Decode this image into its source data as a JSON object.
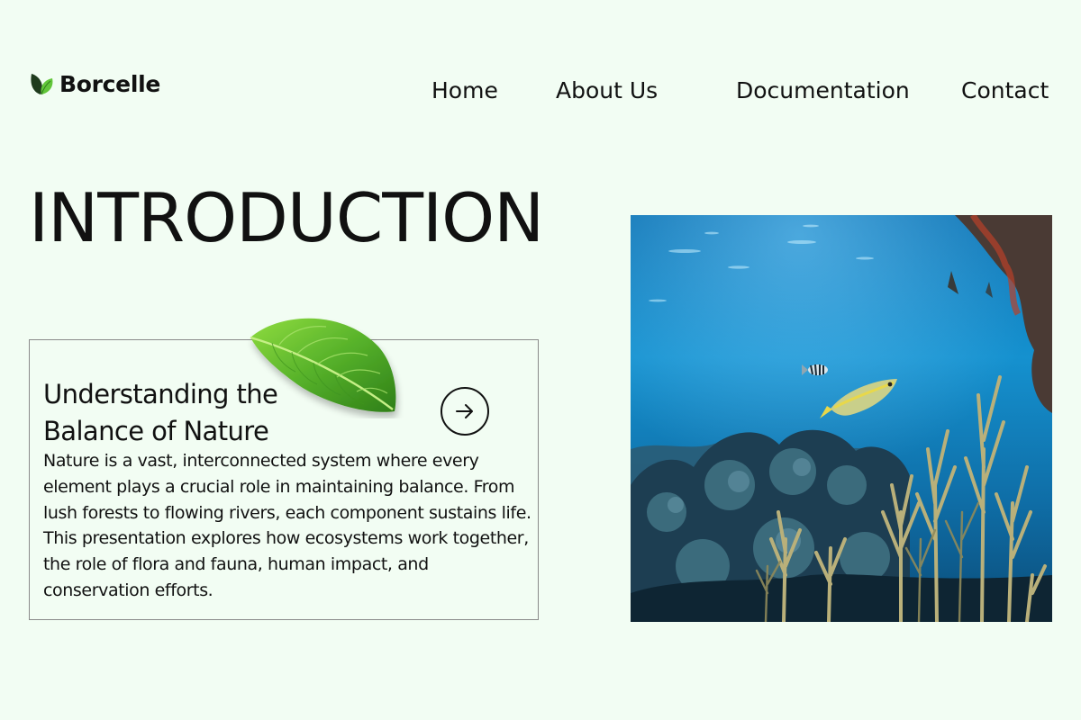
{
  "brand": {
    "name": "Borcelle"
  },
  "nav": {
    "items": [
      {
        "label": "Home"
      },
      {
        "label": "About Us"
      },
      {
        "label": "Documentation"
      },
      {
        "label": "Contact"
      }
    ]
  },
  "hero": {
    "title": "INTRODUCTION"
  },
  "card": {
    "title": "Understanding the Balance of Nature",
    "body": "Nature is a vast, interconnected system where every element plays a crucial role in maintaining balance. From lush forests to flowing rivers, each component sustains life. This presentation explores how ecosystems work together, the role of flora and fauna, human impact, and conservation efforts."
  },
  "icons": {
    "brand_logo": "leaf-icon",
    "card_action": "arrow-right-icon"
  },
  "colors": {
    "background": "#f2fdf3",
    "text": "#111111",
    "leaf_green": "#4caf2a",
    "ocean_blue": "#0a73b5"
  }
}
